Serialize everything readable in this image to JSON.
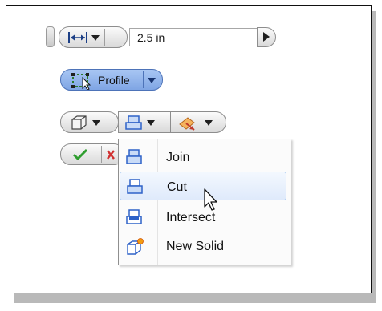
{
  "toolbar": {
    "distance_value": "2.5 in",
    "profile_label": "Profile"
  },
  "menu": {
    "items": [
      {
        "label": "Join",
        "icon": "join-icon"
      },
      {
        "label": "Cut",
        "icon": "cut-icon"
      },
      {
        "label": "Intersect",
        "icon": "intersect-icon"
      },
      {
        "label": "New Solid",
        "icon": "new-solid-icon"
      }
    ],
    "highlighted_item": "Cut"
  },
  "colors": {
    "profile_highlight": "#8fb3ec",
    "icon_blue": "#2e62c8",
    "ok_green": "#2f9e2f",
    "cancel_red": "#d13030",
    "menu_hover": "#dfeafb"
  }
}
